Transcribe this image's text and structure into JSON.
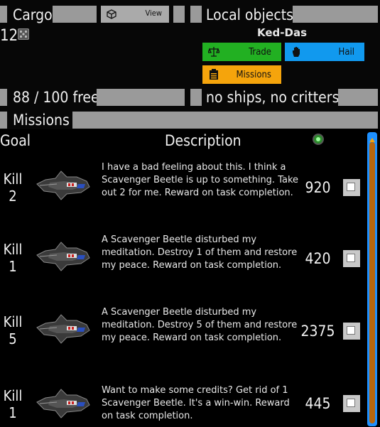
{
  "cargo": {
    "title": "Cargo",
    "view_label": "View",
    "count": "12",
    "free": "88 / 100 free"
  },
  "local": {
    "title": "Local objects",
    "name": "Ked-Das",
    "trade_label": "Trade",
    "hail_label": "Hail",
    "missions_label": "Missions",
    "status": "no ships, no critters"
  },
  "missions": {
    "title": "Missions",
    "col_goal": "Goal",
    "col_description": "Description",
    "rows": [
      {
        "goal_verb": "Kill",
        "goal_count": "2",
        "description": "I have a bad feeling about this. I think a Scavenger Beetle is up to something. Take out 2 for me. Reward on task completion.",
        "reward": "920"
      },
      {
        "goal_verb": "Kill",
        "goal_count": "1",
        "description": "A Scavenger Beetle disturbed my meditation. Destroy 1 of them and restore my peace. Reward on task completion.",
        "reward": "420"
      },
      {
        "goal_verb": "Kill",
        "goal_count": "5",
        "description": "A Scavenger Beetle disturbed my meditation. Destroy 5 of them and restore my peace. Reward on task completion.",
        "reward": "2375"
      },
      {
        "goal_verb": "Kill",
        "goal_count": "1",
        "description": "Want to make some credits? Get rid of 1 Scavenger Beetle. It's a win-win. Reward on task completion.",
        "reward": "445"
      }
    ]
  },
  "icons": {
    "cargo_icon": "dice-icon",
    "view_icon": "cube-icon",
    "trade_icon": "scales-icon",
    "hail_icon": "hand-icon",
    "missions_icon": "clipboard-icon",
    "reward_col_icon": "credit-orb-icon"
  },
  "colors": {
    "trade": "#22b022",
    "hail": "#1199ee",
    "missions": "#f5a40c",
    "bar": "#9a9a9a",
    "scroll_track": "#1e90ff",
    "scroll_thumb": "#b8660c"
  }
}
